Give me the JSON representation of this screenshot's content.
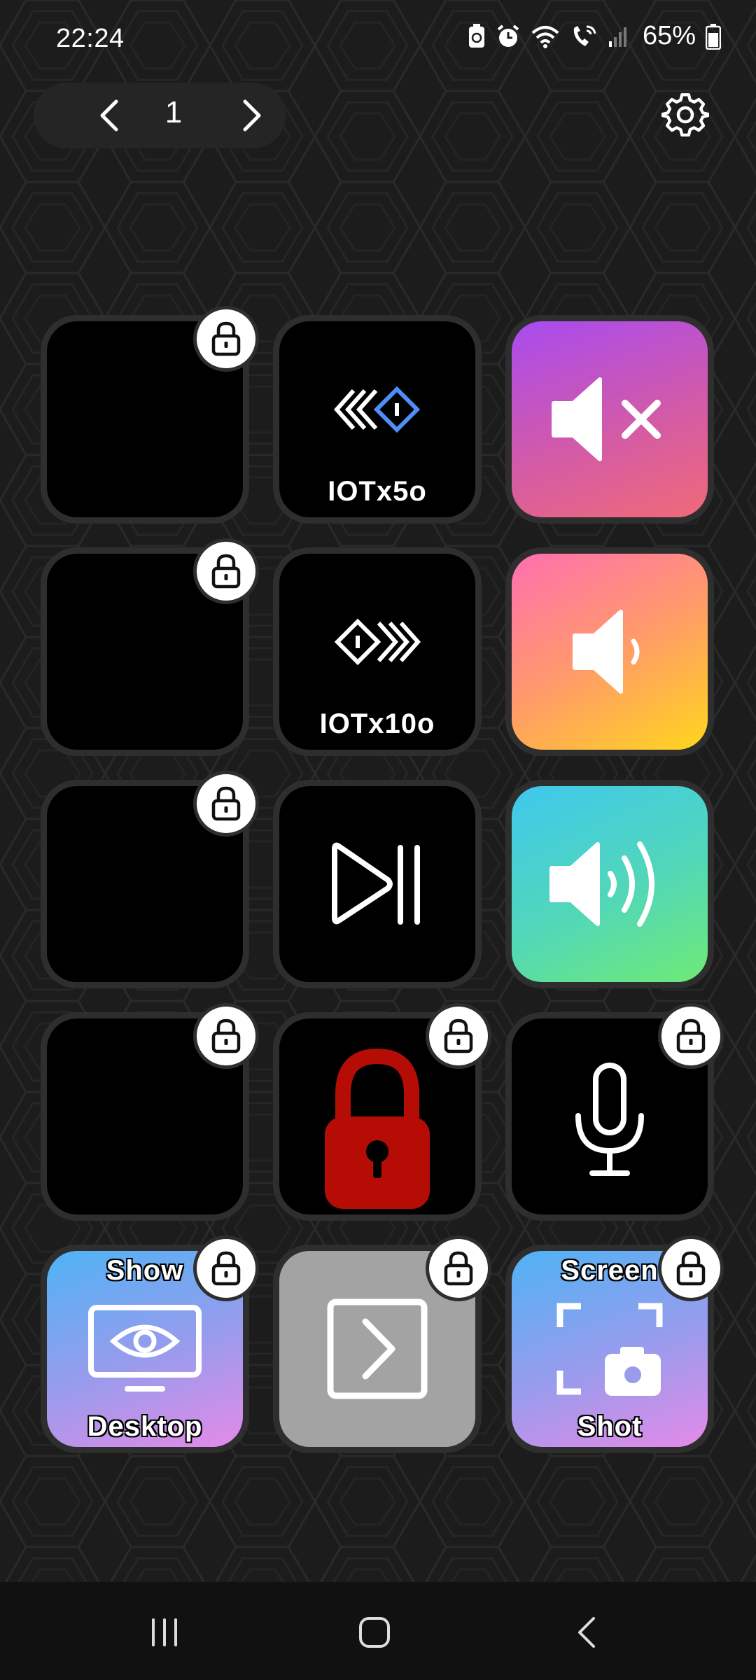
{
  "status_bar": {
    "time": "22:24",
    "battery": "65%",
    "icons": [
      "battery-saver-icon",
      "alarm-icon",
      "wifi-icon",
      "wifi-calling-icon",
      "signal-icon",
      "battery-icon"
    ]
  },
  "pager": {
    "current_page": "1",
    "prev_icon": "chevron-left-icon",
    "next_icon": "chevron-right-icon"
  },
  "settings": {
    "icon": "gear-icon"
  },
  "tiles": [
    {
      "row": 1,
      "col": 1,
      "label": "",
      "locked": true
    },
    {
      "row": 1,
      "col": 2,
      "label": "IOTx5o",
      "icon": "rewind-diamond-icon",
      "locked": false
    },
    {
      "row": 1,
      "col": 3,
      "label": "",
      "icon": "mute-icon",
      "locked": false
    },
    {
      "row": 2,
      "col": 1,
      "label": "",
      "locked": true
    },
    {
      "row": 2,
      "col": 2,
      "label": "IOTx10o",
      "icon": "forward-diamond-icon",
      "locked": false
    },
    {
      "row": 2,
      "col": 3,
      "label": "",
      "icon": "volume-low-icon",
      "locked": false
    },
    {
      "row": 3,
      "col": 1,
      "label": "",
      "locked": true
    },
    {
      "row": 3,
      "col": 2,
      "label": "",
      "icon": "play-pause-icon",
      "locked": false
    },
    {
      "row": 3,
      "col": 3,
      "label": "",
      "icon": "volume-high-icon",
      "locked": false
    },
    {
      "row": 4,
      "col": 1,
      "label": "",
      "locked": true
    },
    {
      "row": 4,
      "col": 2,
      "label": "",
      "icon": "padlock-icon",
      "locked": true
    },
    {
      "row": 4,
      "col": 3,
      "label": "",
      "icon": "microphone-icon",
      "locked": true
    },
    {
      "row": 5,
      "col": 1,
      "label_top": "Show",
      "label_bottom": "Desktop",
      "icon": "monitor-eye-icon",
      "locked": true
    },
    {
      "row": 5,
      "col": 2,
      "label": "",
      "icon": "terminal-chevron-icon",
      "locked": true
    },
    {
      "row": 5,
      "col": 3,
      "label_top": "Screen",
      "label_bottom": "Shot",
      "icon": "screenshot-icon",
      "locked": true
    }
  ],
  "colors": {
    "background": "#1c1c1c",
    "tile": "#000000",
    "tile_border": "#2e2e2e",
    "diamond_accent": "#4f8ef7",
    "padlock_red": "#b50d05"
  },
  "nav_bar": {
    "recents_icon": "recents-icon",
    "home_icon": "home-icon",
    "back_icon": "back-icon"
  }
}
